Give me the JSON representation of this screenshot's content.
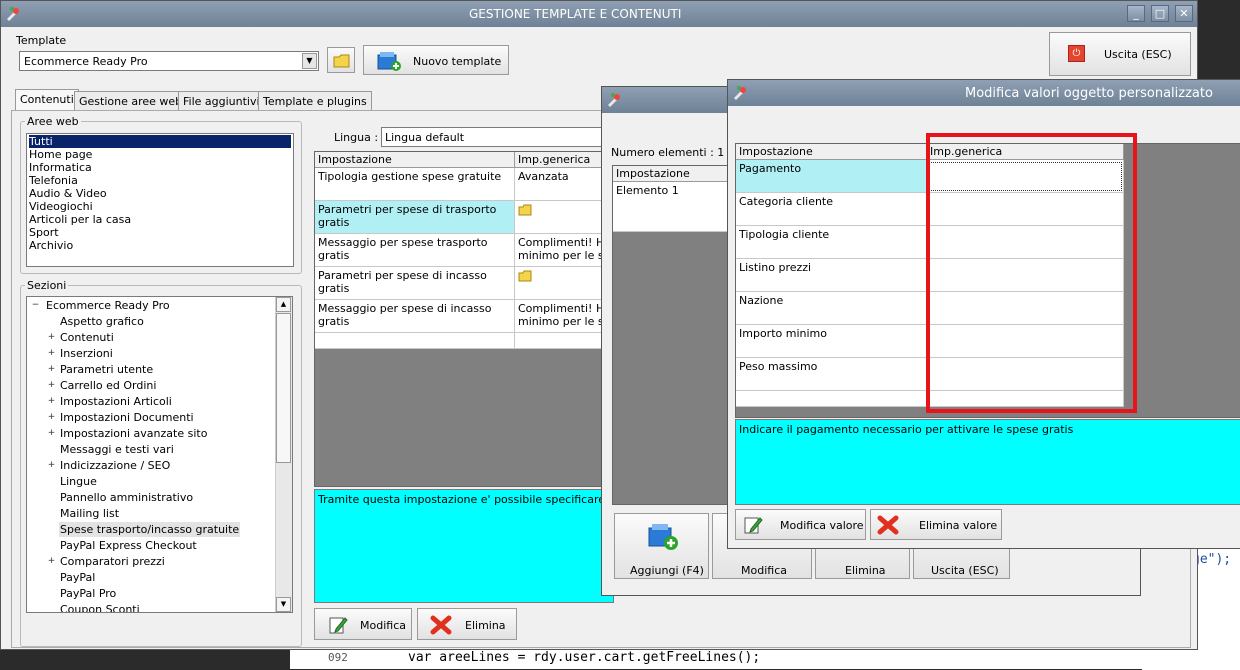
{
  "main": {
    "title": "GESTIONE TEMPLATE E CONTENUTI",
    "template_label": "Template",
    "template_value": "Ecommerce Ready Pro",
    "new_template": "Nuovo template",
    "exit": "Uscita (ESC)",
    "tabs": [
      "Contenuti",
      "Gestione aree web",
      "File aggiuntivi",
      "Template e plugins"
    ],
    "aree_web_label": "Aree web",
    "aree_web": [
      "Tutti",
      "Home page",
      "Informatica",
      "Telefonia",
      "Audio & Video",
      "Videogiochi",
      "Articoli per la casa",
      "Sport",
      "Archivio"
    ],
    "sezioni_label": "Sezioni",
    "tree": [
      {
        "label": "Ecommerce Ready Pro",
        "exp": "−",
        "lvl": 0
      },
      {
        "label": "Aspetto grafico",
        "exp": "",
        "lvl": 1
      },
      {
        "label": "Contenuti",
        "exp": "+",
        "lvl": 1
      },
      {
        "label": "Inserzioni",
        "exp": "+",
        "lvl": 1
      },
      {
        "label": "Parametri utente",
        "exp": "+",
        "lvl": 1
      },
      {
        "label": "Carrello ed Ordini",
        "exp": "+",
        "lvl": 1
      },
      {
        "label": "Impostazioni Articoli",
        "exp": "+",
        "lvl": 1
      },
      {
        "label": "Impostazioni Documenti",
        "exp": "+",
        "lvl": 1
      },
      {
        "label": "Impostazioni avanzate sito",
        "exp": "+",
        "lvl": 1
      },
      {
        "label": "Messaggi e testi vari",
        "exp": "",
        "lvl": 1
      },
      {
        "label": "Indicizzazione / SEO",
        "exp": "+",
        "lvl": 1
      },
      {
        "label": "Lingue",
        "exp": "",
        "lvl": 1
      },
      {
        "label": "Pannello amministrativo",
        "exp": "",
        "lvl": 1
      },
      {
        "label": "Mailing list",
        "exp": "",
        "lvl": 1
      },
      {
        "label": "Spese trasporto/incasso gratuite",
        "exp": "",
        "lvl": 1
      },
      {
        "label": "PayPal Express Checkout",
        "exp": "",
        "lvl": 1
      },
      {
        "label": "Comparatori prezzi",
        "exp": "+",
        "lvl": 1
      },
      {
        "label": "PayPal",
        "exp": "",
        "lvl": 1
      },
      {
        "label": "PayPal Pro",
        "exp": "",
        "lvl": 1
      },
      {
        "label": "Coupon Sconti",
        "exp": "",
        "lvl": 1
      }
    ],
    "lingua_label": "Lingua :",
    "lingua_value": "Lingua default",
    "grid_headers": [
      "Impostazione",
      "Imp.generica"
    ],
    "grid_rows": [
      {
        "name": "Tipologia gestione spese gratuite",
        "value": "Avanzata"
      },
      {
        "name": "Parametri per spese di trasporto gratis",
        "value": ""
      },
      {
        "name": "Messaggio per spese trasporto gratis",
        "value": "Complimenti! Hai r\nminimo per le spe"
      },
      {
        "name": "Parametri per spese di incasso gratis",
        "value": ""
      },
      {
        "name": "Messaggio per spese di incasso gratis",
        "value": "Complimenti! Hai r\nminimo per le spes"
      }
    ],
    "description": "Tramite questa impostazione e' possibile specificare le casist",
    "modifica": "Modifica",
    "elimina": "Elimina"
  },
  "mid": {
    "count": "Numero elementi : 1",
    "header": "Impostazione",
    "item": "Elemento 1",
    "buttons": [
      "Aggiungi (F4)",
      "Modifica",
      "Elimina",
      "Uscita (ESC)"
    ]
  },
  "dialog": {
    "title": "Modifica valori oggetto personalizzato",
    "headers": [
      "Impostazione",
      "Imp.generica"
    ],
    "rows": [
      "Pagamento",
      "Categoria cliente",
      "Tipologia cliente",
      "Listino prezzi",
      "Nazione",
      "Importo minimo",
      "Peso massimo"
    ],
    "description": "Indicare il pagamento necessario per attivare le spese gratis",
    "modifica_valore": "Modifica valore",
    "elimina_valore": "Elimina valore"
  },
  "code": {
    "line_no": "092",
    "line_text": "var areeLines = rdy.user.cart.getFreeLines();",
    "side_text": "ge\");"
  },
  "colors": {
    "cyan": "#00ffff",
    "highlight": "#b0f0f4",
    "select": "#0a246a",
    "annotation": "#e8141c"
  }
}
